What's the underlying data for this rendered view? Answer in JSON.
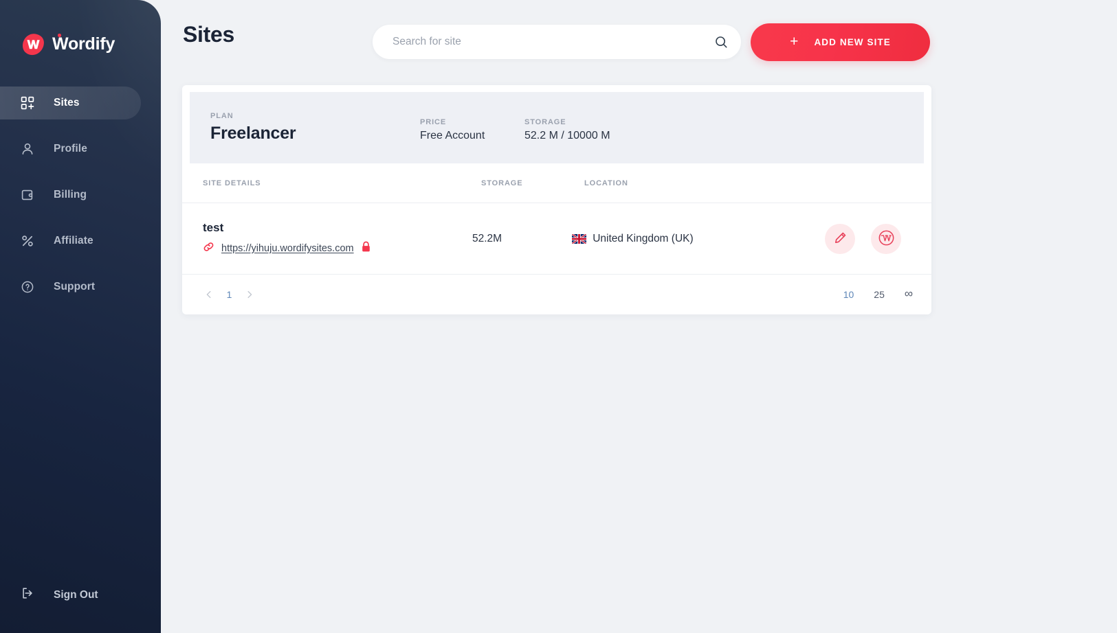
{
  "brand": {
    "name": "Wordify",
    "logo_icon": "wordify-w-logo",
    "accent": "#f4364c"
  },
  "sidebar": {
    "items": [
      {
        "label": "Sites",
        "icon": "grid-plus-icon",
        "active": true
      },
      {
        "label": "Profile",
        "icon": "user-icon",
        "active": false
      },
      {
        "label": "Billing",
        "icon": "wallet-icon",
        "active": false
      },
      {
        "label": "Affiliate",
        "icon": "percent-icon",
        "active": false
      },
      {
        "label": "Support",
        "icon": "question-circle-icon",
        "active": false
      }
    ],
    "signout": {
      "label": "Sign Out",
      "icon": "logout-icon"
    }
  },
  "header": {
    "title": "Sites",
    "search": {
      "placeholder": "Search for site",
      "value": "",
      "icon": "search-icon"
    },
    "add_button": {
      "label": "ADD NEW SITE",
      "icon": "plus-icon"
    }
  },
  "plan_bar": {
    "plan_label": "PLAN",
    "plan_value": "Freelancer",
    "price_label": "PRICE",
    "price_value": "Free Account",
    "storage_label": "STORAGE",
    "storage_value": "52.2 M / 10000 M"
  },
  "table": {
    "columns": [
      "SITE DETAILS",
      "STORAGE",
      "LOCATION"
    ],
    "rows": [
      {
        "name": "test",
        "url": "https://yihuju.wordifysites.com",
        "link_icon": "link-icon",
        "lock_icon": "lock-icon",
        "storage": "52.2M",
        "location": "United Kingdom (UK)",
        "flag": "uk-flag-icon",
        "actions": [
          {
            "name": "edit-site-button",
            "icon": "pencil-icon"
          },
          {
            "name": "wordpress-admin-button",
            "icon": "wordpress-icon"
          }
        ]
      }
    ]
  },
  "pagination": {
    "prev_icon": "chevron-left-icon",
    "next_icon": "chevron-right-icon",
    "pages": [
      "1"
    ],
    "current_page": "1",
    "page_sizes": [
      "10",
      "25",
      "∞"
    ],
    "active_page_size": "10"
  }
}
